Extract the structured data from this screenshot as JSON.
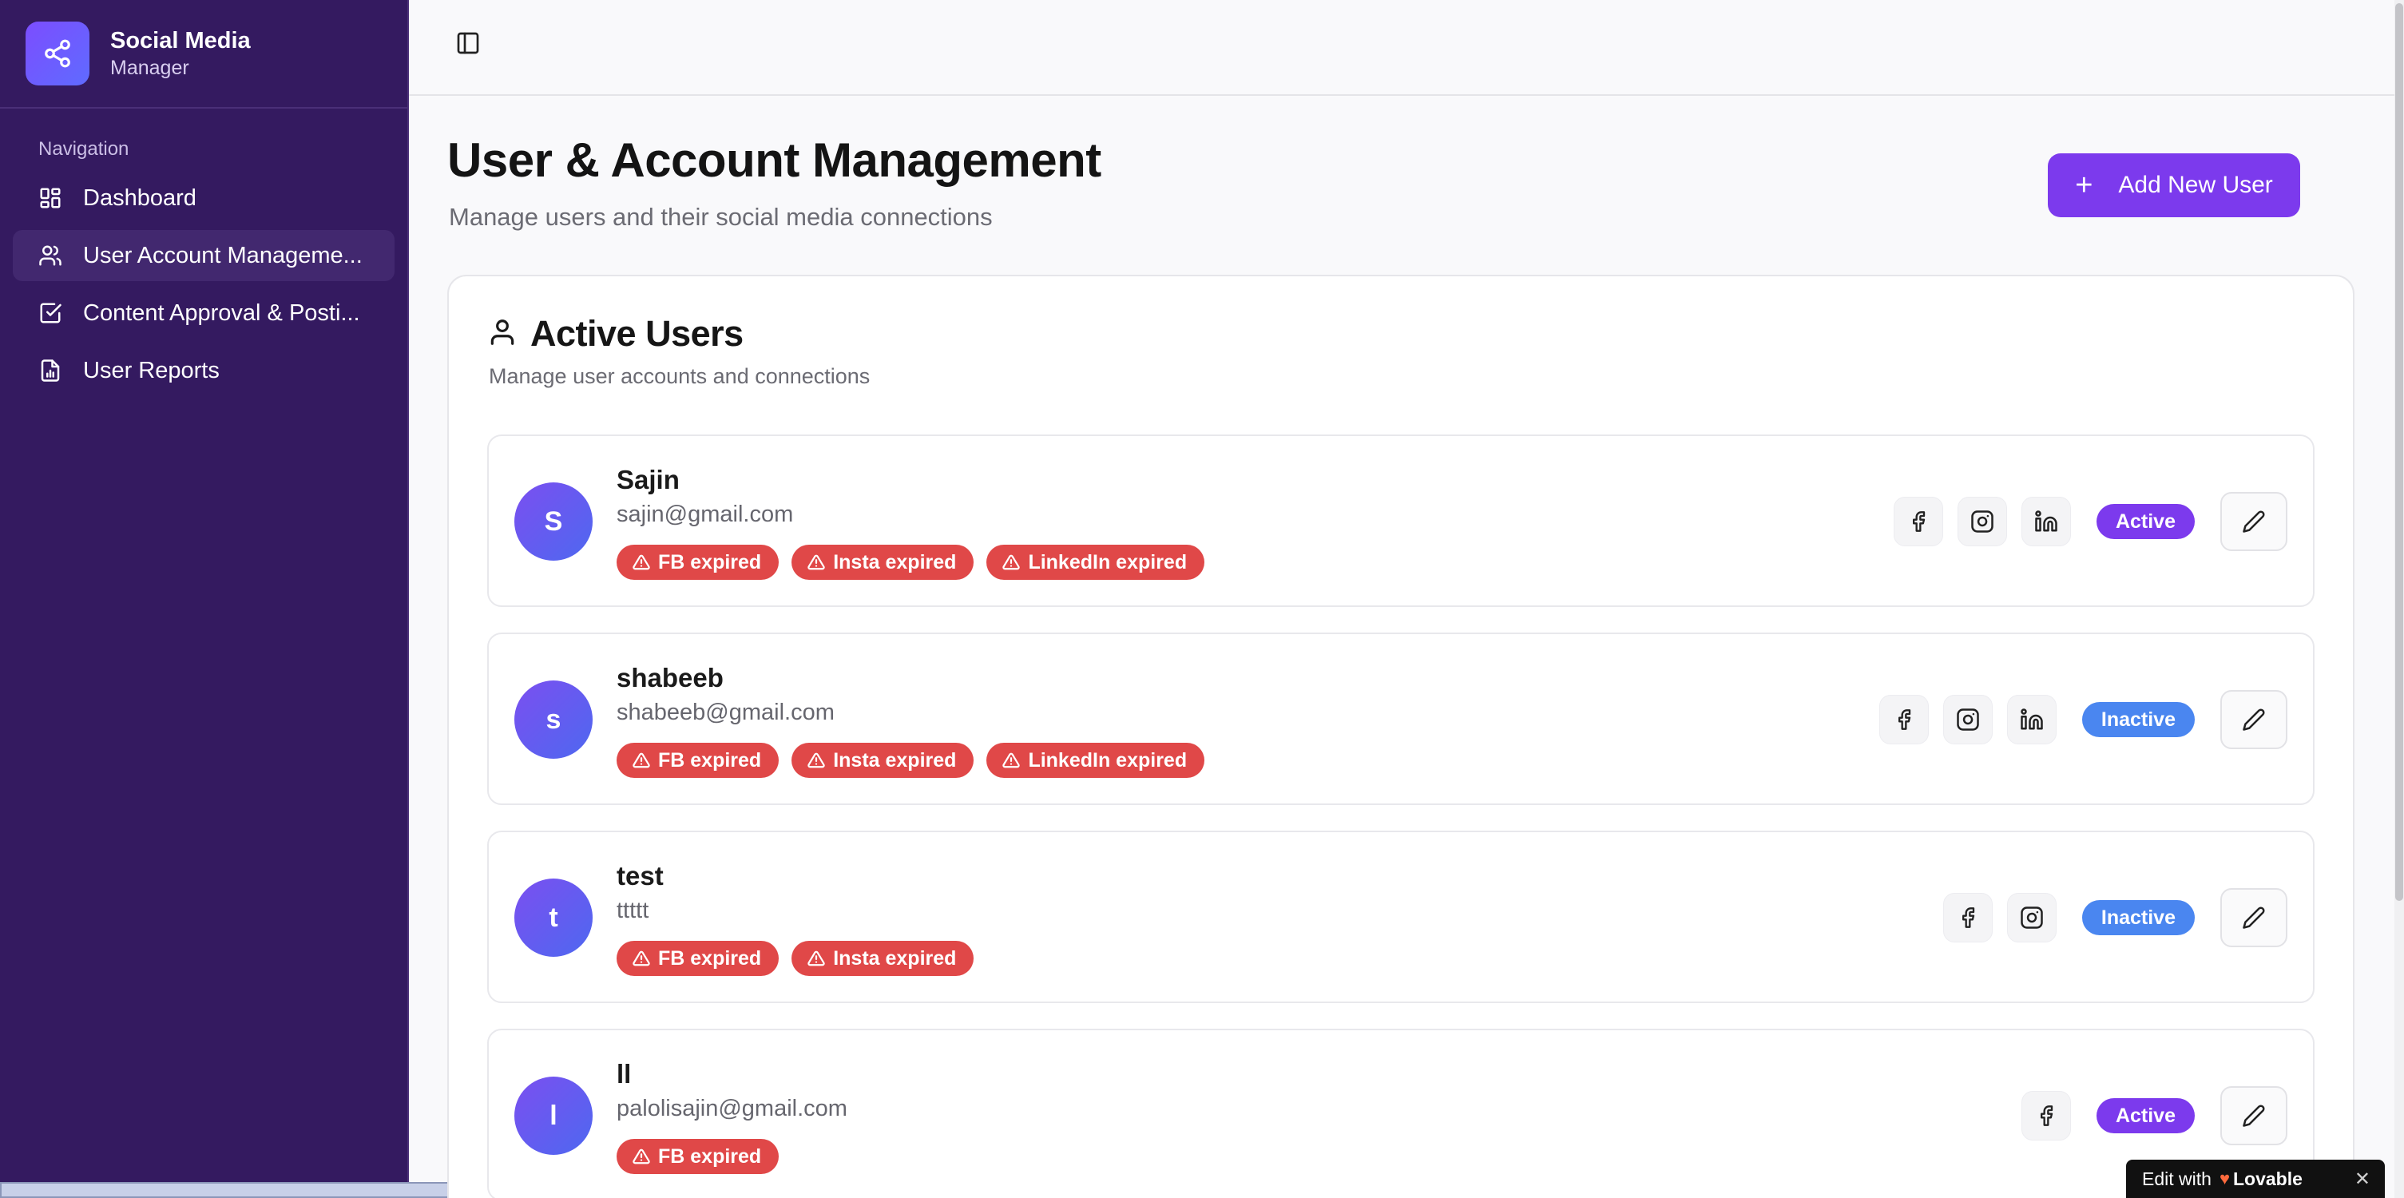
{
  "sidebar": {
    "brand_title": "Social Media",
    "brand_sub": "Manager",
    "nav_label": "Navigation",
    "items": [
      {
        "label": "Dashboard"
      },
      {
        "label": "User Account Manageme..."
      },
      {
        "label": "Content Approval & Posti..."
      },
      {
        "label": "User Reports"
      }
    ]
  },
  "header": {
    "title": "User & Account Management",
    "subtitle": "Manage users and their social media connections",
    "add_button": "Add New User"
  },
  "card": {
    "title": "Active Users",
    "subtitle": "Manage user accounts and connections"
  },
  "users": [
    {
      "initial": "S",
      "name": "Sajin",
      "email": "sajin@gmail.com",
      "badges": [
        "FB expired",
        "Insta expired",
        "LinkedIn expired"
      ],
      "status": "Active"
    },
    {
      "initial": "s",
      "name": "shabeeb",
      "email": "shabeeb@gmail.com",
      "badges": [
        "FB expired",
        "Insta expired",
        "LinkedIn expired"
      ],
      "status": "Inactive"
    },
    {
      "initial": "t",
      "name": "test",
      "email": "ttttt",
      "badges": [
        "FB expired",
        "Insta expired"
      ],
      "status": "Inactive"
    },
    {
      "initial": "l",
      "name": "ll",
      "email": "palolisajin@gmail.com",
      "badges": [
        "FB expired"
      ],
      "status": "Active"
    }
  ],
  "lovable": {
    "prefix": "Edit with",
    "brand": "Lovable",
    "close": "✕"
  },
  "colors": {
    "sidebar_bg": "#341a60",
    "accent": "#7c3aed",
    "inactive": "#4a86f0",
    "expired": "#e04848"
  },
  "icons": {
    "brand": "share-icon",
    "toggle": "panel-left-icon",
    "nav": [
      "layout-grid-icon",
      "users-icon",
      "check-square-icon",
      "file-chart-icon"
    ],
    "add": "plus-icon",
    "card": "user-icon",
    "badge": "alert-triangle-icon",
    "social": [
      "facebook-icon",
      "instagram-icon",
      "linkedin-icon"
    ],
    "edit": "pencil-icon"
  }
}
